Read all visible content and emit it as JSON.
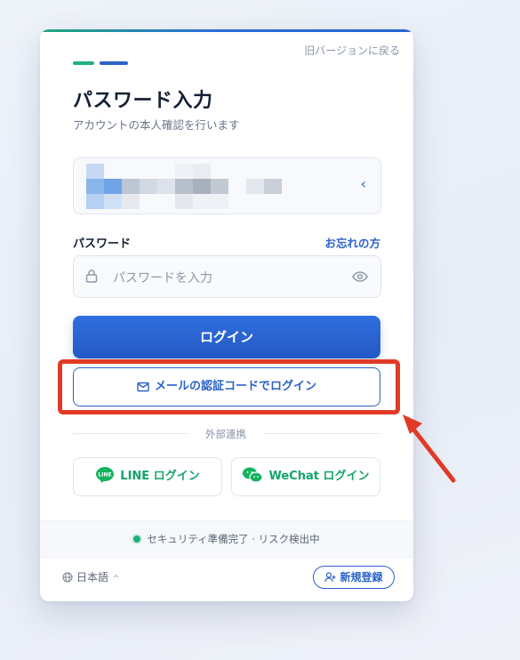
{
  "header": {
    "back_link": "旧バージョンに戻る",
    "title": "パスワード入力",
    "subtitle": "アカウントの本人確認を行います"
  },
  "account": {
    "masked": true,
    "chevron_icon": "chevron-left-icon"
  },
  "password": {
    "label": "パスワード",
    "forgot_link": "お忘れの方",
    "placeholder": "パスワードを入力",
    "value": "",
    "lock_icon": "lock-icon",
    "visibility_icon": "eye-icon"
  },
  "actions": {
    "login_label": "ログイン",
    "email_login_label": "メールの認証コードでログイン"
  },
  "external": {
    "divider_label": "外部連携",
    "line_label": "LINE ログイン",
    "wechat_label": "WeChat ログイン"
  },
  "security": {
    "status_text": "セキュリティ準備完了 · リスク検出中"
  },
  "footer": {
    "language": "日本語",
    "signup_label": "新規登録"
  },
  "colors": {
    "primary": "#2a62c9",
    "accent_green": "#1fb07e",
    "line_green": "#13a46a",
    "annotation_red": "#e03a27"
  }
}
